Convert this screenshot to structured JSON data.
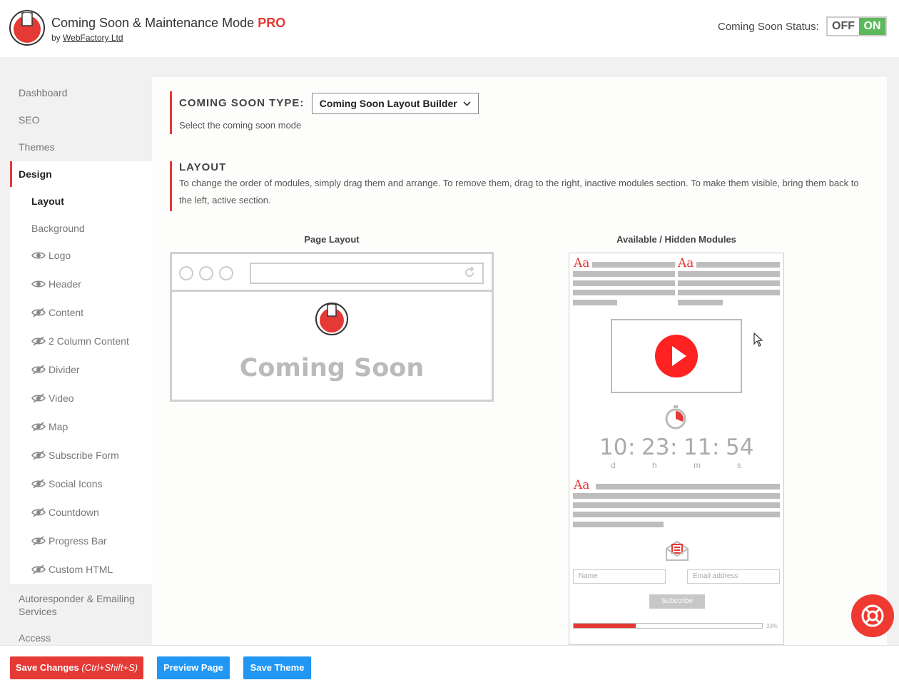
{
  "header": {
    "title": "Coming Soon & Maintenance Mode",
    "pro_badge": "PRO",
    "by_label": "by",
    "company": "WebFactory Ltd",
    "status_label": "Coming Soon Status:",
    "toggle_off": "OFF",
    "toggle_on": "ON",
    "status_value": "ON"
  },
  "sidebar": {
    "items": [
      {
        "label": "Dashboard"
      },
      {
        "label": "SEO"
      },
      {
        "label": "Themes"
      },
      {
        "label": "Design"
      }
    ],
    "design_sub": [
      {
        "label": "Layout"
      },
      {
        "label": "Background"
      }
    ],
    "modules": [
      {
        "label": "Logo",
        "visible": true
      },
      {
        "label": "Header",
        "visible": true
      },
      {
        "label": "Content",
        "visible": false
      },
      {
        "label": "2 Column Content",
        "visible": false
      },
      {
        "label": "Divider",
        "visible": false
      },
      {
        "label": "Video",
        "visible": false
      },
      {
        "label": "Map",
        "visible": false
      },
      {
        "label": "Subscribe Form",
        "visible": false
      },
      {
        "label": "Social Icons",
        "visible": false
      },
      {
        "label": "Countdown",
        "visible": false
      },
      {
        "label": "Progress Bar",
        "visible": false
      },
      {
        "label": "Custom HTML",
        "visible": false
      }
    ],
    "after": [
      {
        "label": "Autoresponder & Emailing Services"
      },
      {
        "label": "Access"
      }
    ]
  },
  "type_section": {
    "title": "COMING SOON TYPE:",
    "selected": "Coming Soon Layout Builder",
    "desc": "Select the coming soon mode"
  },
  "layout_section": {
    "title": "LAYOUT",
    "desc": "To change the order of modules, simply drag them and arrange. To remove them, drag to the right, inactive modules section. To make them visible, bring them back to the left, active section."
  },
  "columns": {
    "page_layout": "Page Layout",
    "available": "Available / Hidden Modules"
  },
  "preview": {
    "headline": "Coming Soon"
  },
  "modules_preview": {
    "aa": "Aa",
    "countdown": {
      "d": "10",
      "h": "23",
      "m": "11",
      "s": "54",
      "sep": ":",
      "d_label": "d",
      "h_label": "h",
      "m_label": "m",
      "s_label": "s"
    },
    "name_placeholder": "Name",
    "email_placeholder": "Email address",
    "subscribe_label": "Subscribe",
    "progress_percent": 33,
    "progress_label": "33%"
  },
  "footer": {
    "save_label": "Save Changes",
    "save_shortcut": "(Ctrl+Shift+S)",
    "preview_label": "Preview Page",
    "save_theme_label": "Save Theme"
  },
  "colors": {
    "accent": "#e53935",
    "blue": "#2196f3",
    "toggle_on": "#5cb85c"
  }
}
